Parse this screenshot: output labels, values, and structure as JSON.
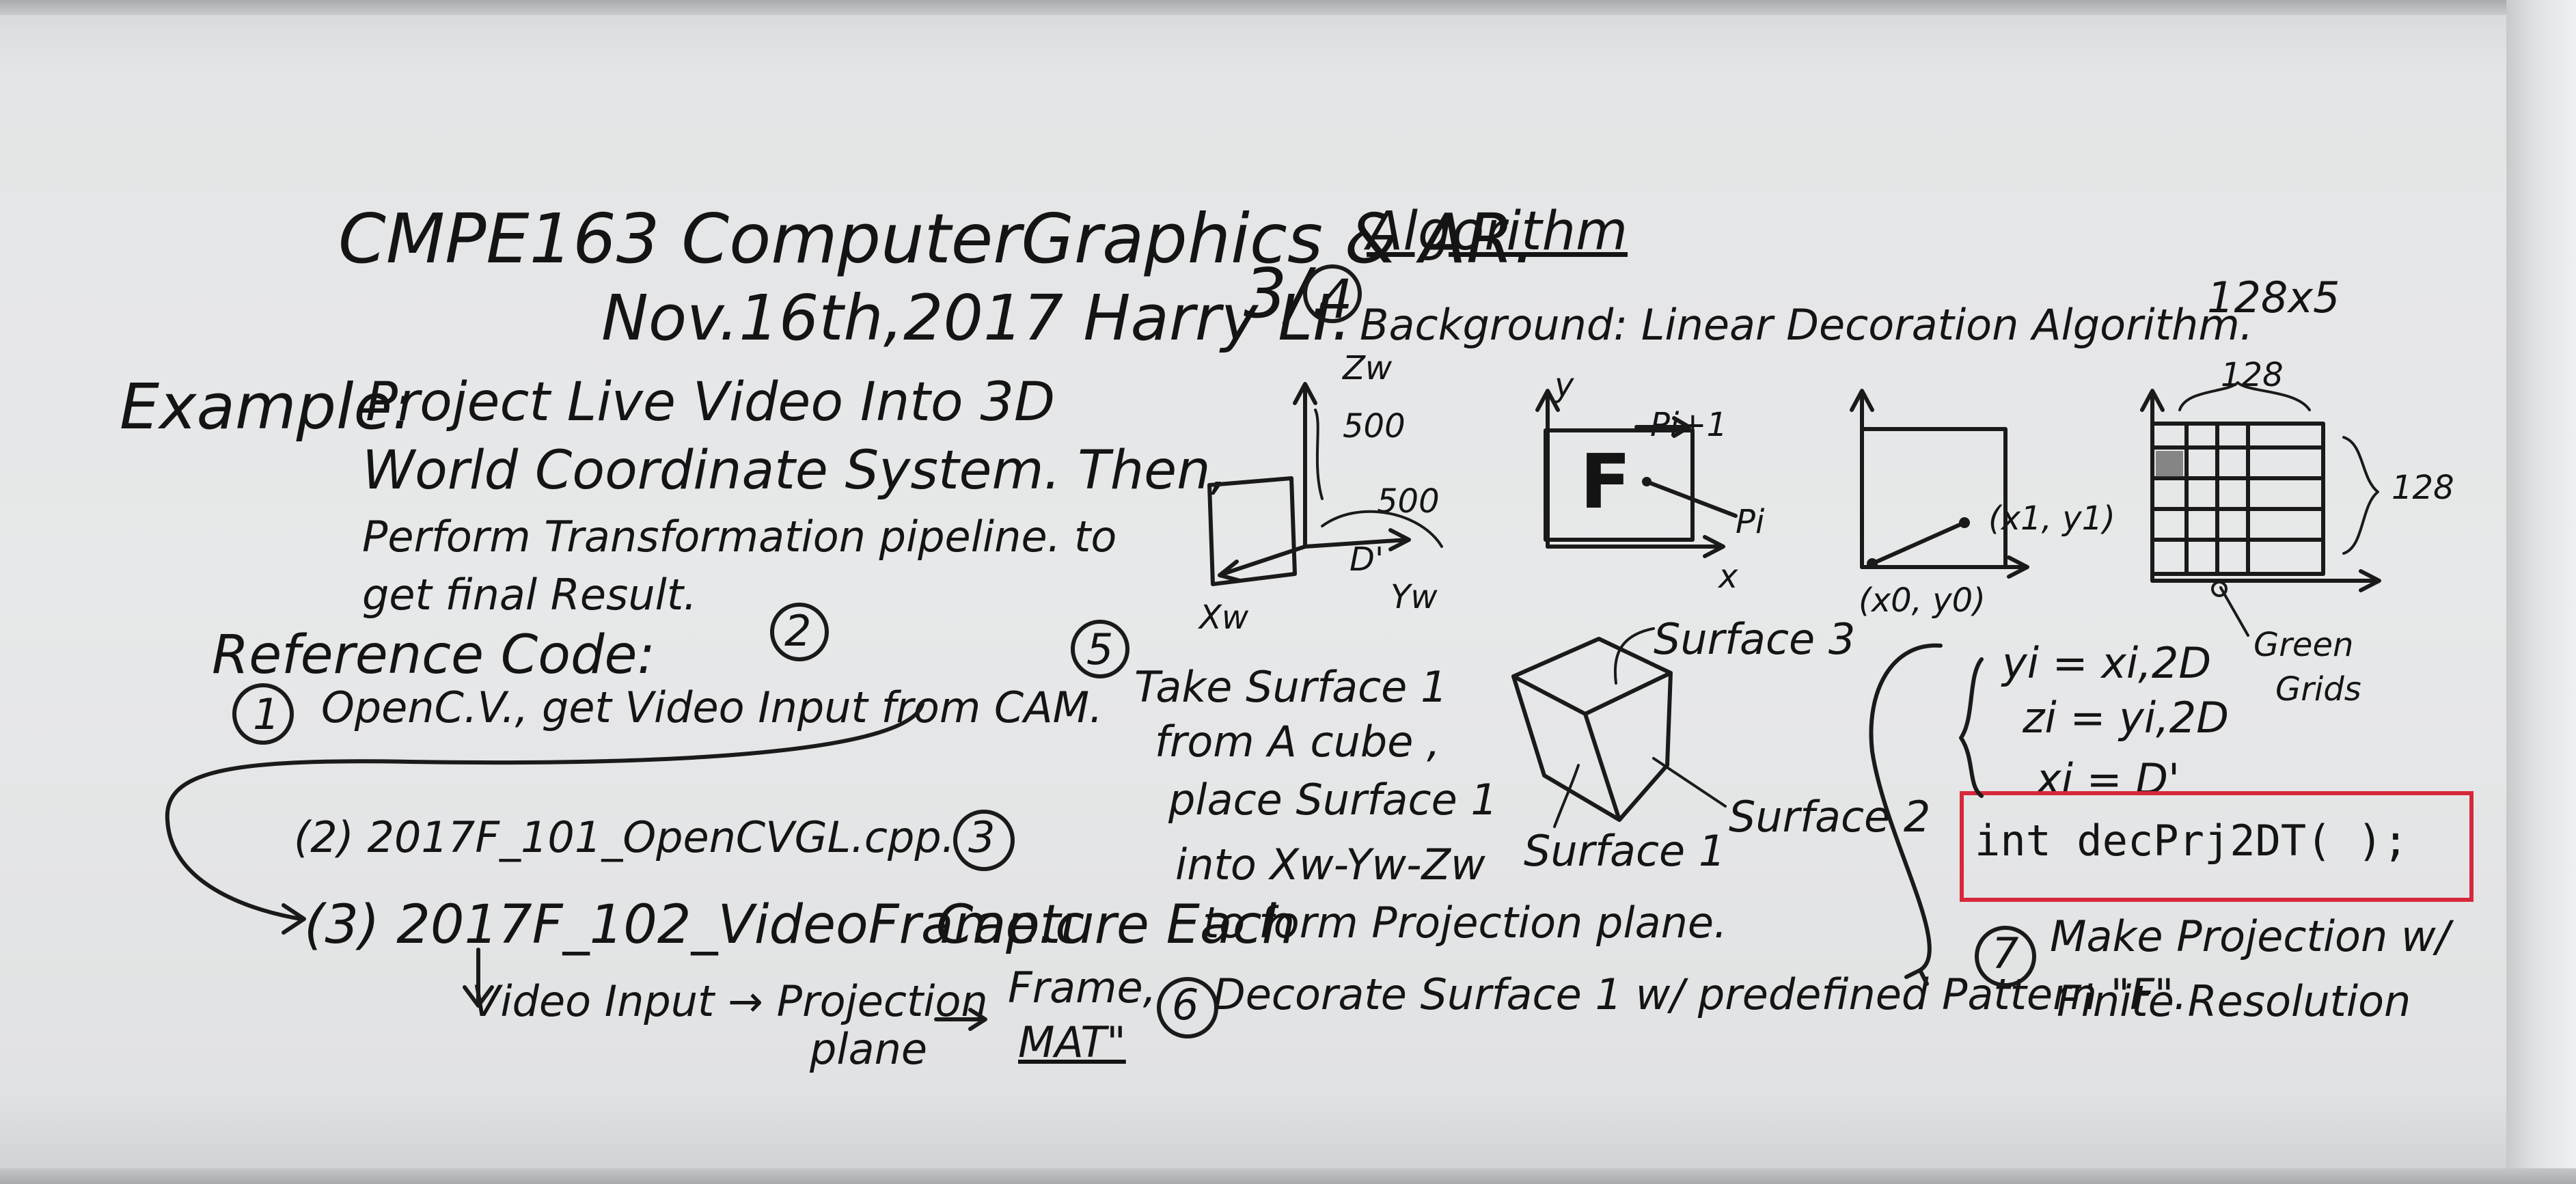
{
  "board": {
    "title": "CMPE163 ComputerGraphics & AR.",
    "date_author": "Nov.16th,2017 Harry LI.",
    "page_mark": "3/.",
    "algorithm_header": "Algorithm",
    "step4": "4",
    "background_line": "Background: Linear Decoration Algorithm.",
    "resolution": "128x5",
    "example_label": "Example:",
    "example_lines": [
      "Project Live Video Into 3D",
      "World Coordinate System. Then,",
      "Perform Transformation pipeline. to",
      "get final Result."
    ],
    "reference_label": "Reference Code:",
    "ref_num2": "2",
    "ref1_num": "1",
    "ref1_text": "OpenC.V., get Video Input from CAM.",
    "ref2_text": "(2) 2017F_101_OpenCVGL.cpp.",
    "ref3_text": "(3) 2017F_102_VideoFrame.c",
    "step3": "3",
    "capture_text": "Capture Each",
    "form_text": "to form Projection plane.",
    "pipeline_text": "Video Input → Projection",
    "pipeline_plane": "plane",
    "frame_label": "Frame,",
    "mat_label": "MAT\"",
    "step5": "5",
    "step5_lines": [
      "Take Surface 1",
      "from A cube ,",
      "place Surface 1",
      "into Xw-Yw-Zw"
    ],
    "step6": "6",
    "step6_text": "Decorate Surface 1 w/ predefined Pattern \"F\".",
    "step7": "7",
    "step7_lines": [
      "Make Projection w/",
      "Finite Resolution"
    ],
    "axes1": {
      "zw": "Zw",
      "v500a": "500",
      "v500b": "500",
      "d1": "D'",
      "xw": "Xw",
      "yw": "Yw"
    },
    "axes2": {
      "y": "y",
      "pi1": "Pi+1",
      "F": "F",
      "pi": "Pi",
      "x": "x"
    },
    "axes3": {
      "p1": "(x1, y1)",
      "p0": "(x0, y0)"
    },
    "grid": {
      "top": "128",
      "side": "128",
      "green_label": "Green",
      "grids_label": "Grids",
      "dots": ":"
    },
    "cube": {
      "surface3": "Surface 3",
      "surface2": "Surface 2",
      "surface1": "Surface 1"
    },
    "equations": [
      "yi = xi,2D",
      "zi = yi,2D",
      "xi = D'"
    ],
    "code_line": "int decPrj2DT(        );"
  }
}
